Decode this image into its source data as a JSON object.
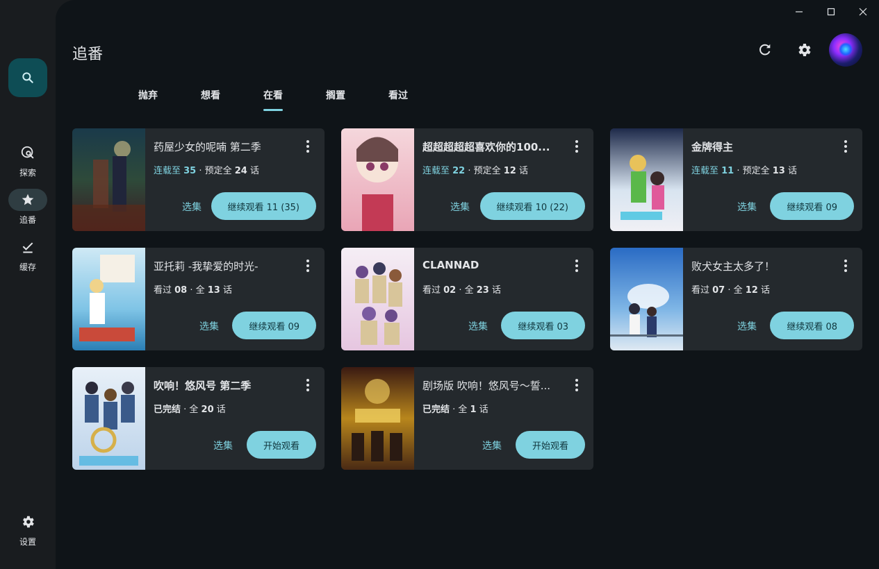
{
  "app": {
    "title": "追番"
  },
  "sidebar": {
    "items": [
      {
        "label": "探索",
        "icon": "explore-icon"
      },
      {
        "label": "追番",
        "icon": "star-icon"
      },
      {
        "label": "缓存",
        "icon": "check-icon"
      },
      {
        "label": "设置",
        "icon": "gear-icon"
      }
    ],
    "search_icon": "search-icon"
  },
  "tabs": [
    "抛弃",
    "想看",
    "在看",
    "搁置",
    "看过"
  ],
  "active_tab": "在看",
  "colors": {
    "accent": "#7fd2e0",
    "card": "#24292d",
    "background": "#0f1418"
  },
  "cards": [
    {
      "title": "药屋少女的呢喃 第二季",
      "status_a": "连载至 ",
      "status_a_num": "35",
      "status_b": " · 预定全 ",
      "status_b_num": "24",
      "status_c": " 话",
      "episodes": "选集",
      "cta": "继续观看 11 (35)"
    },
    {
      "title": "超超超超超喜欢你的100...",
      "status_a": "连载至 ",
      "status_a_num": "22",
      "status_b": " · 预定全 ",
      "status_b_num": "12",
      "status_c": " 话",
      "episodes": "选集",
      "cta": "继续观看 10 (22)"
    },
    {
      "title": "金牌得主",
      "status_a": "连载至 ",
      "status_a_num": "11",
      "status_b": " · 预定全 ",
      "status_b_num": "13",
      "status_c": " 话",
      "episodes": "选集",
      "cta": "继续观看 09"
    },
    {
      "title": "亚托莉 -我挚爱的时光-",
      "status_a": "看过 ",
      "status_a_num": "08",
      "status_b": " · 全 ",
      "status_b_num": "13",
      "status_c": " 话",
      "episodes": "选集",
      "cta": "继续观看 09"
    },
    {
      "title": "CLANNAD",
      "status_a": "看过 ",
      "status_a_num": "02",
      "status_b": " · 全 ",
      "status_b_num": "23",
      "status_c": " 话",
      "episodes": "选集",
      "cta": "继续观看 03"
    },
    {
      "title": "败犬女主太多了！",
      "status_a": "看过 ",
      "status_a_num": "07",
      "status_b": " · 全 ",
      "status_b_num": "12",
      "status_c": " 话",
      "episodes": "选集",
      "cta": "继续观看 08"
    },
    {
      "title": "吹响！悠风号 第二季",
      "status_a": "已完结",
      "status_a_num": "",
      "status_b": " · 全 ",
      "status_b_num": "20",
      "status_c": " 话",
      "episodes": "选集",
      "cta": "开始观看"
    },
    {
      "title": "剧场版 吹响！悠风号～誓...",
      "status_a": "已完结",
      "status_a_num": "",
      "status_b": " · 全 ",
      "status_b_num": "1",
      "status_c": " 话",
      "episodes": "选集",
      "cta": "开始观看"
    }
  ]
}
